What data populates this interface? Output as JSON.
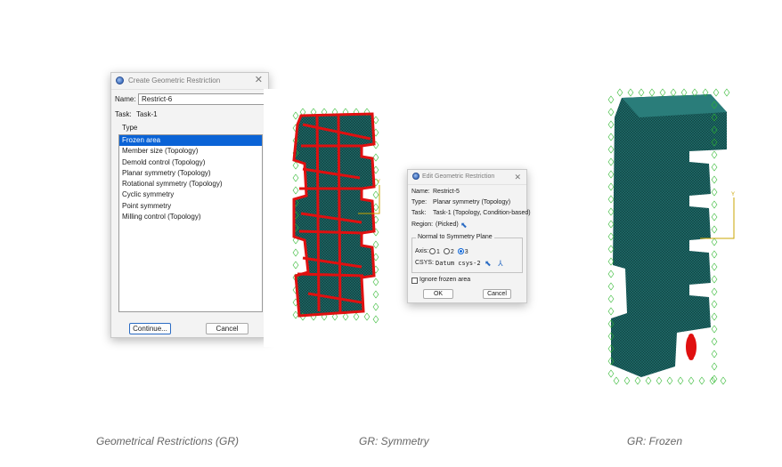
{
  "create_dialog": {
    "title": "Create Geometric Restriction",
    "name_label": "Name:",
    "name_value": "Restrict-6",
    "task_label": "Task:",
    "task_value": "Task-1",
    "type_header": "Type",
    "type_items": [
      {
        "label": "Frozen area",
        "selected": true
      },
      {
        "label": "Member size (Topology)",
        "selected": false
      },
      {
        "label": "Demold control (Topology)",
        "selected": false
      },
      {
        "label": "Planar symmetry (Topology)",
        "selected": false
      },
      {
        "label": "Rotational symmetry (Topology)",
        "selected": false
      },
      {
        "label": "Cyclic symmetry",
        "selected": false
      },
      {
        "label": "Point symmetry",
        "selected": false
      },
      {
        "label": "Milling control (Topology)",
        "selected": false
      }
    ],
    "continue_label": "Continue...",
    "cancel_label": "Cancel"
  },
  "edit_dialog": {
    "title": "Edit Geometric Restriction",
    "name_label": "Name:",
    "name_value": "Restrict-5",
    "type_label": "Type:",
    "type_value": "Planar symmetry (Topology)",
    "task_label": "Task:",
    "task_value": "Task-1 (Topology, Condition-based)",
    "region_label": "Region:",
    "region_value": "(Picked)",
    "group_title": "Normal to Symmetry Plane",
    "axis_label": "Axis:",
    "axis_options": [
      "1",
      "2",
      "3"
    ],
    "axis_selected": "3",
    "csys_label": "CSYS:",
    "csys_value": "Datum csys-2",
    "ignore_frozen_label": "Ignore frozen area",
    "ignore_frozen_checked": false,
    "ok_label": "OK",
    "cancel_label": "Cancel"
  },
  "model_views": {
    "triad_axis_label": "Y",
    "mesh_color": "#1a5c5a",
    "symmetry_highlight_color": "#e01010",
    "frozen_highlight_color": "#e01010",
    "constraint_symbol_color": "#2fb82f"
  },
  "captions": {
    "left": "Geometrical Restrictions (GR)",
    "middle": "GR: Symmetry",
    "right": "GR: Frozen"
  }
}
